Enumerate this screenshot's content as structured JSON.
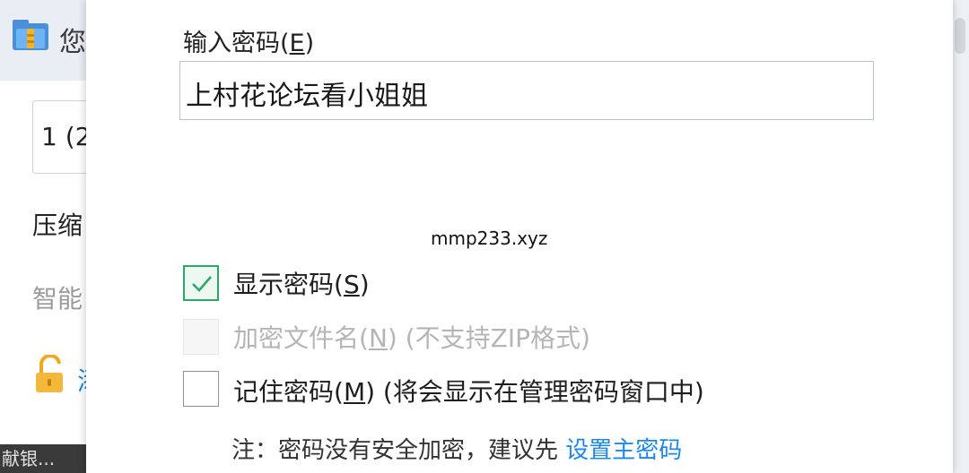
{
  "background_window": {
    "title_partial": "您",
    "path_partial": "1 (2",
    "label_compress_partial": "压缩",
    "label_smart_partial": "智能",
    "lock_text_partial": "添",
    "status_partial": "献银..."
  },
  "dialog": {
    "enter_password_label": "输入密码(",
    "enter_password_hotkey": "E",
    "enter_password_close": ")",
    "password_value": "上村花论坛看小姐姐",
    "watermark": "mmp233.xyz",
    "options": [
      {
        "label_pre": "显示密码(",
        "hotkey": "S",
        "label_post": ")",
        "checked": true,
        "disabled": false
      },
      {
        "label_pre": "加密文件名(",
        "hotkey": "N",
        "label_post": ") (不支持ZIP格式)",
        "checked": false,
        "disabled": true
      },
      {
        "label_pre": "记住密码(",
        "hotkey": "M",
        "label_post": ") (将会显示在管理密码窗口中)",
        "checked": false,
        "disabled": false
      }
    ],
    "note_text": "注：密码没有安全加密，建议先 ",
    "note_link": "设置主密码"
  },
  "colors": {
    "accent_green": "#2da868",
    "link_blue": "#1e88e5",
    "disabled_text": "#b5b5b5"
  },
  "icons": {
    "app": "archive-folder-icon",
    "lock": "unlock-icon",
    "check": "checkmark-icon"
  }
}
